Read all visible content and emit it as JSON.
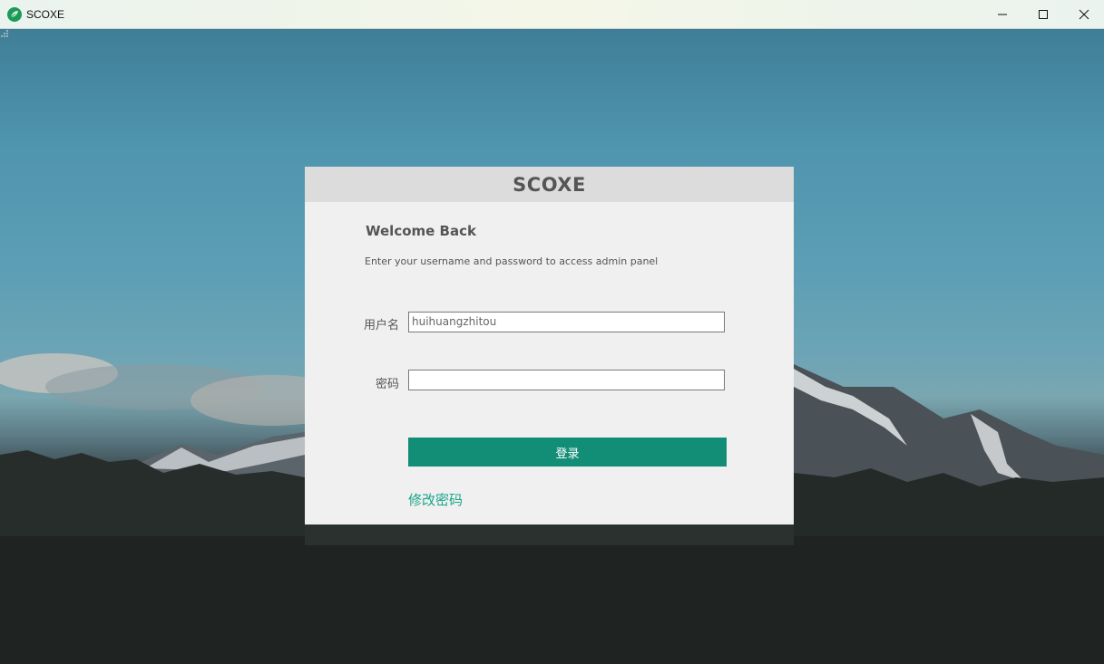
{
  "window": {
    "title": "SCOXE",
    "controls": [
      "minimize-icon",
      "maximize-icon",
      "close-icon"
    ]
  },
  "login": {
    "header_title": "SCOXE",
    "welcome": "Welcome Back",
    "subtitle": "Enter your username and password to access admin panel",
    "username_label": "用户名",
    "username_value": "huihuangzhitou",
    "password_label": "密码",
    "password_value": "",
    "login_button": "登录",
    "change_password_link": "修改密码"
  },
  "colors": {
    "accent": "#138e76",
    "link": "#19a58a",
    "card_bg": "#f0f0f0",
    "card_header_bg": "#dcdcdc"
  }
}
